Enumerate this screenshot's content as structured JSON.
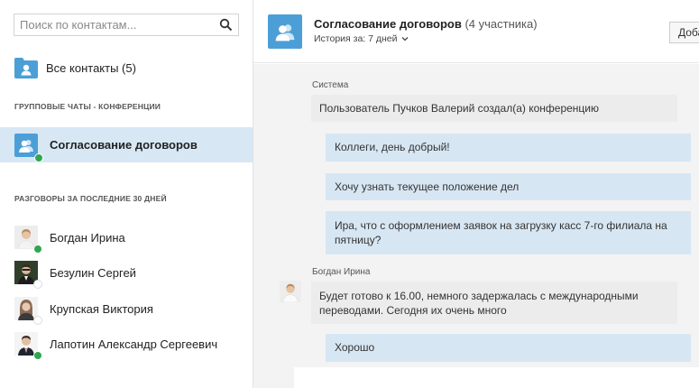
{
  "search": {
    "placeholder": "Поиск по контактам..."
  },
  "all_contacts": {
    "label": "Все контакты (5)"
  },
  "sections": {
    "group_chats": "ГРУППОВЫЕ ЧАТЫ - КОНФЕРЕНЦИИ",
    "recent": "РАЗГОВОРЫ ЗА ПОСЛЕДНИЕ 30 ДНЕЙ"
  },
  "active_chat": {
    "label": "Согласование договоров",
    "status": "online"
  },
  "contacts": [
    {
      "name": "Богдан Ирина",
      "status": "online"
    },
    {
      "name": "Безулин Сергей",
      "status": "offline"
    },
    {
      "name": "Крупская Виктория",
      "status": "offline"
    },
    {
      "name": "Лапотин Александр Сергеевич",
      "status": "online"
    }
  ],
  "header": {
    "title": "Согласование договоров",
    "participants": "(4 участника)",
    "history": "История за: 7 дней",
    "add_button": "Доба"
  },
  "messages": [
    {
      "sender": "Система",
      "text": "Пользователь Пучков Валерий создал(а) конференцию",
      "direction": "incoming"
    },
    {
      "text": "Коллеги, день добрый!",
      "direction": "outgoing"
    },
    {
      "text": "Хочу узнать текущее положение дел",
      "direction": "outgoing"
    },
    {
      "text": "Ира, что с оформлением заявок на загрузку касс 7-го филиала на пятницу?",
      "direction": "outgoing"
    },
    {
      "sender": "Богдан Ирина",
      "text": "Будет готово к 16.00, немного задержалась с международными переводами. Сегодня их очень много",
      "direction": "incoming"
    },
    {
      "text": "Хорошо",
      "direction": "outgoing"
    }
  ],
  "colors": {
    "accent": "#4c9fd6",
    "active_bg": "#d7e7f4",
    "outgoing_bubble": "#d7e6f3",
    "incoming_bubble": "#ececec",
    "online": "#2fa650"
  },
  "icons": {
    "search": "search-icon",
    "folder": "folder-user-icon",
    "group": "group-chat-icon",
    "chevron": "chevron-down-icon"
  }
}
